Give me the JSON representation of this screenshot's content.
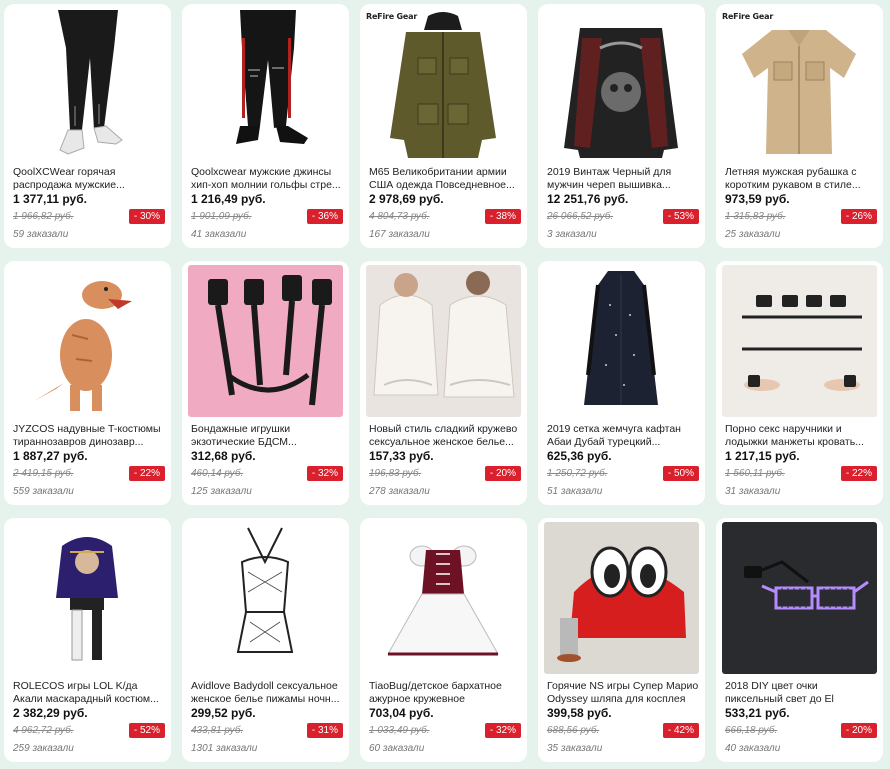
{
  "products": [
    {
      "brand": "",
      "title": "QoolXCWear горячая распродажа мужские...",
      "price": "1 377,11 руб.",
      "old_price": "1 966,82 руб.",
      "discount": "- 30%",
      "orders": "59 заказали"
    },
    {
      "brand": "",
      "title": "Qoolxcwear мужские джинсы хип-хоп молнии гольфы стре...",
      "price": "1 216,49 руб.",
      "old_price": "1 901,09 руб.",
      "discount": "- 36%",
      "orders": "41 заказали"
    },
    {
      "brand": "ReFire Gear",
      "title": "M65 Великобритании армии США одежда Повседневное...",
      "price": "2 978,69 руб.",
      "old_price": "4 804,73 руб.",
      "discount": "- 38%",
      "orders": "167 заказали"
    },
    {
      "brand": "",
      "title": "2019 Винтаж Черный для мужчин череп вышивка...",
      "price": "12 251,76 руб.",
      "old_price": "26 066,52 руб.",
      "discount": "- 53%",
      "orders": "3 заказали"
    },
    {
      "brand": "ReFire Gear",
      "title": "Летняя мужская рубашка с коротким рукавом в стиле...",
      "price": "973,59 руб.",
      "old_price": "1 315,83 руб.",
      "discount": "- 26%",
      "orders": "25 заказали"
    },
    {
      "brand": "",
      "title": "JYZCOS надувные T-костюмы тираннозавров динозавр...",
      "price": "1 887,27 руб.",
      "old_price": "2 419,15 руб.",
      "discount": "- 22%",
      "orders": "559 заказали"
    },
    {
      "brand": "",
      "title": "Бондажные игрушки экзотические БДСМ...",
      "price": "312,68 руб.",
      "old_price": "460,14 руб.",
      "discount": "- 32%",
      "orders": "125 заказали"
    },
    {
      "brand": "",
      "title": "Новый стиль сладкий кружево сексуальное женское белье...",
      "price": "157,33 руб.",
      "old_price": "196,83 руб.",
      "discount": "- 20%",
      "orders": "278 заказали"
    },
    {
      "brand": "",
      "title": "2019 сетка жемчуга кафтан Абаи Дубай турецкий...",
      "price": "625,36 руб.",
      "old_price": "1 250,72 руб.",
      "discount": "- 50%",
      "orders": "51 заказали"
    },
    {
      "brand": "",
      "title": "Порно секс наручники и лодыжки манжеты кровать...",
      "price": "1 217,15 руб.",
      "old_price": "1 560,11 руб.",
      "discount": "- 22%",
      "orders": "31 заказали"
    },
    {
      "brand": "",
      "title": "ROLECOS игры LOL K/да Акали маскарадный костюм...",
      "price": "2 382,29 руб.",
      "old_price": "4 962,72 руб.",
      "discount": "- 52%",
      "orders": "259 заказали"
    },
    {
      "brand": "",
      "title": "Avidlove Badydoll сексуальное женское белье пижамы ночн...",
      "price": "299,52 руб.",
      "old_price": "433,81 руб.",
      "discount": "- 31%",
      "orders": "1301 заказали"
    },
    {
      "brand": "",
      "title": "TiaoBug/детское бархатное ажурное кружевное балетное...",
      "price": "703,04 руб.",
      "old_price": "1 033,49 руб.",
      "discount": "- 32%",
      "orders": "60 заказали"
    },
    {
      "brand": "",
      "title": "Горячие NS игры Супер Марио Odyssey шляпа для косплея",
      "price": "399,58 руб.",
      "old_price": "688,56 руб.",
      "discount": "- 42%",
      "orders": "35 заказали"
    },
    {
      "brand": "",
      "title": "2018 DIY цвет очки пиксельный свет до El провода светодио...",
      "price": "533,21 руб.",
      "old_price": "666,18 руб.",
      "discount": "- 20%",
      "orders": "40 заказали"
    }
  ],
  "colors": {
    "page_bg": "#e6f3ec",
    "card_bg": "#ffffff",
    "discount_bg": "#d9202c"
  }
}
